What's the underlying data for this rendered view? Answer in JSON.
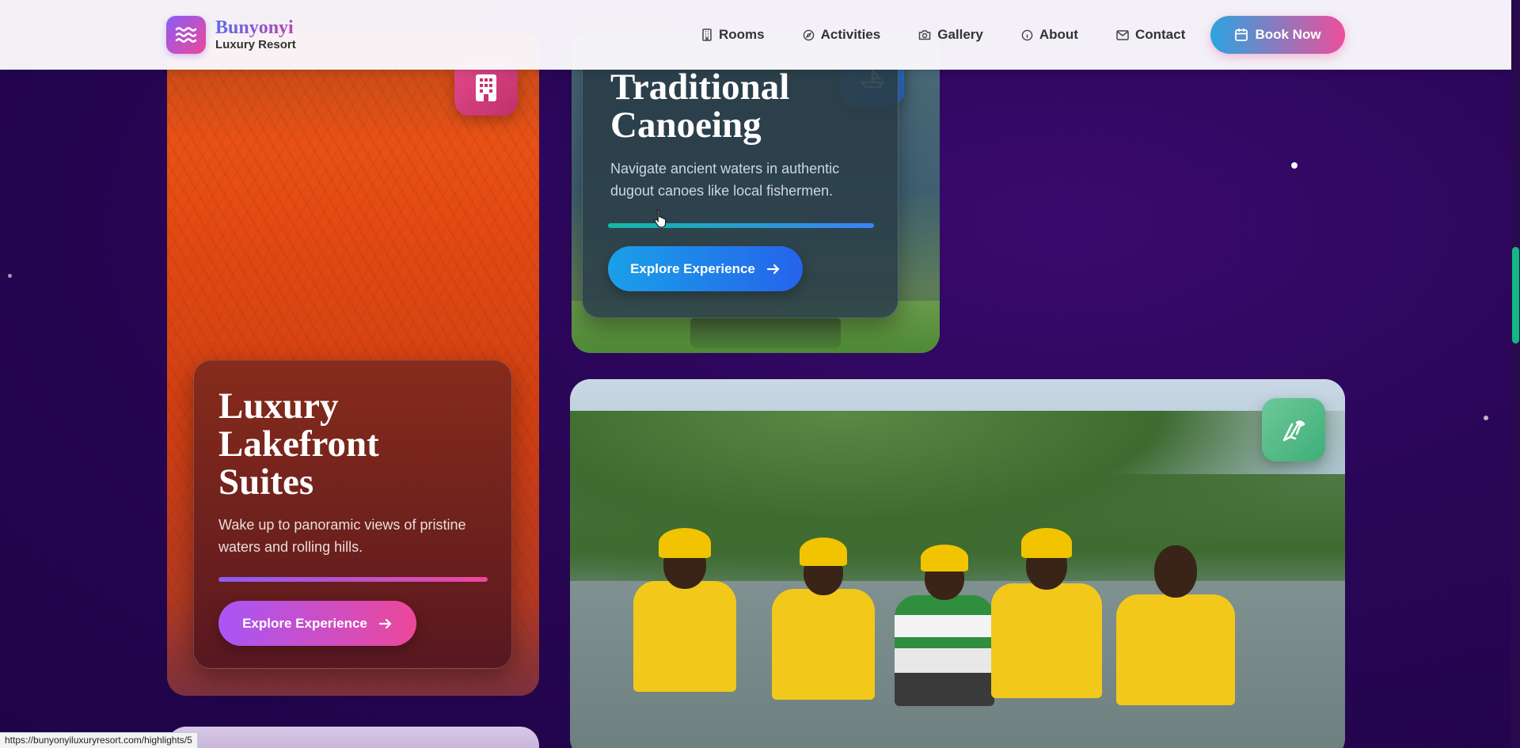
{
  "brand": {
    "name": "Bunyonyi",
    "subtitle": "Luxury Resort"
  },
  "nav": [
    {
      "label": "Rooms",
      "icon": "building-icon"
    },
    {
      "label": "Activities",
      "icon": "compass-icon"
    },
    {
      "label": "Gallery",
      "icon": "camera-icon"
    },
    {
      "label": "About",
      "icon": "info-icon"
    },
    {
      "label": "Contact",
      "icon": "mail-icon"
    }
  ],
  "book_button": {
    "label": "Book Now",
    "icon": "calendar-icon"
  },
  "cards": {
    "suites": {
      "title_lines": [
        "Luxury",
        "Lakefront",
        "Suites"
      ],
      "description_lines": [
        "Wake up to panoramic views of pristine",
        "waters and rolling hills."
      ],
      "button": "Explore Experience",
      "badge_icon": "hotel-building-icon",
      "accent": "#d6336c"
    },
    "canoe": {
      "title_lines": [
        "Traditional",
        "Canoeing"
      ],
      "description_lines": [
        "Navigate ancient waters in authentic",
        "dugout canoes like local fishermen."
      ],
      "button": "Explore Experience",
      "badge_icon": "sailboat-icon",
      "accent": "#1f8fd6"
    },
    "team": {
      "badge_icon": "bird-icon",
      "accent": "#4fbf86"
    }
  },
  "status_bar": {
    "url": "https://bunyonyiluxuryresort.com/highlights/5"
  },
  "colors": {
    "background": "#2a0658",
    "brand_gradient": [
      "#8b5cf6",
      "#ec4899"
    ],
    "book_gradient": [
      "#2ba4e0",
      "#ec4f9a"
    ],
    "scroll_thumb": "#10b981"
  }
}
